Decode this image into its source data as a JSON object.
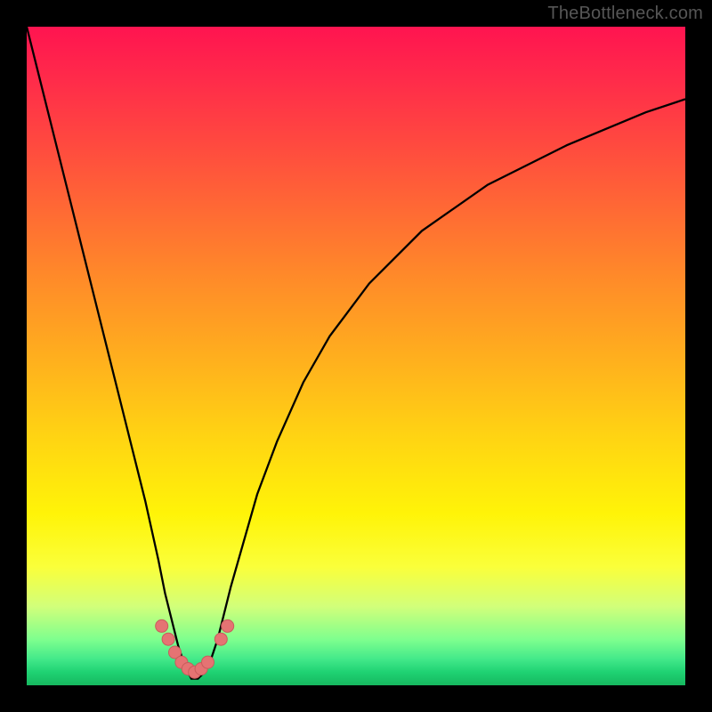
{
  "watermark": "TheBottleneck.com",
  "colors": {
    "frame": "#000000",
    "curve_stroke": "#000000",
    "marker_fill": "#e57373",
    "marker_stroke": "#c95c5c"
  },
  "chart_data": {
    "type": "line",
    "title": "",
    "xlabel": "",
    "ylabel": "",
    "xlim": [
      0,
      100
    ],
    "ylim": [
      0,
      100
    ],
    "series": [
      {
        "name": "bottleneck-curve",
        "x": [
          0,
          2,
          4,
          6,
          8,
          10,
          12,
          14,
          16,
          18,
          20,
          21,
          22,
          23,
          24,
          25,
          26,
          27,
          28,
          29,
          30,
          31,
          33,
          35,
          38,
          42,
          46,
          52,
          60,
          70,
          82,
          94,
          100
        ],
        "y": [
          100,
          92,
          84,
          76,
          68,
          60,
          52,
          44,
          36,
          28,
          19,
          14,
          10,
          6,
          3,
          1,
          1,
          2,
          4,
          7,
          11,
          15,
          22,
          29,
          37,
          46,
          53,
          61,
          69,
          76,
          82,
          87,
          89
        ]
      }
    ],
    "markers": {
      "name": "bottom-dots",
      "points": [
        {
          "x": 20.5,
          "y": 9
        },
        {
          "x": 21.5,
          "y": 7
        },
        {
          "x": 22.5,
          "y": 5
        },
        {
          "x": 23.5,
          "y": 3.5
        },
        {
          "x": 24.5,
          "y": 2.5
        },
        {
          "x": 25.5,
          "y": 2
        },
        {
          "x": 26.5,
          "y": 2.5
        },
        {
          "x": 27.5,
          "y": 3.5
        },
        {
          "x": 29.5,
          "y": 7
        },
        {
          "x": 30.5,
          "y": 9
        }
      ],
      "radius": 7
    }
  }
}
